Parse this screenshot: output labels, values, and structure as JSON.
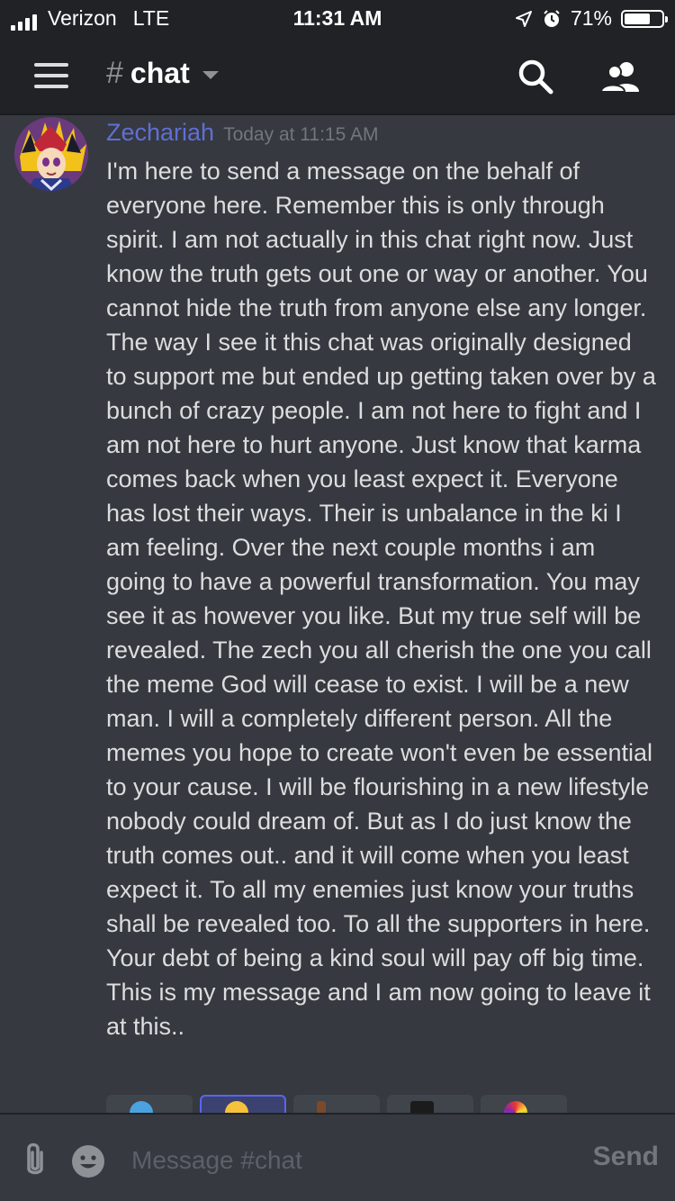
{
  "status_bar": {
    "carrier": "Verizon",
    "network": "LTE",
    "time": "11:31 AM",
    "battery": "71%",
    "battery_level": 0.71
  },
  "header": {
    "channel_symbol": "#",
    "channel_name": "chat",
    "icons": [
      "hamburger-menu-icon",
      "search-icon",
      "members-icon"
    ]
  },
  "message": {
    "author": "Zechariah",
    "timestamp": "Today at 11:15 AM",
    "body": "I'm here to send a message on the behalf  of everyone here. Remember this is only through spirit. I am not actually in this chat right now. Just know the truth gets out one or way or another. You cannot hide the truth from anyone else any longer. The way I see it this chat was originally designed to support me but ended up getting taken over by a bunch of crazy people. I am not here to fight and I am not here to hurt anyone. Just know that karma comes back when you least expect it. Everyone has lost their ways. Their is unbalance in the ki I am feeling. Over the next couple months i am going to have a powerful transformation. You may see it as however you like. But my true self will be revealed. The zech you all cherish the one you call the meme God will cease to exist. I will be a new man. I will a completely different person. All the memes you hope to create won't even be essential to your cause. I will be flourishing in a new lifestyle nobody could dream of. But as I do just know the truth comes out.. and it will come when you least expect it. To all my enemies just know your truths shall be revealed too. To all the supporters in here. Your debt of being a kind soul will pay off big time. This is my message and I am now going to leave it at this.."
  },
  "composer": {
    "placeholder": "Message #chat",
    "send_label": "Send"
  },
  "colors": {
    "background": "#36393f",
    "header": "#202225",
    "author": "#5f6fd6",
    "text": "#dcddde",
    "muted": "#72767d"
  }
}
